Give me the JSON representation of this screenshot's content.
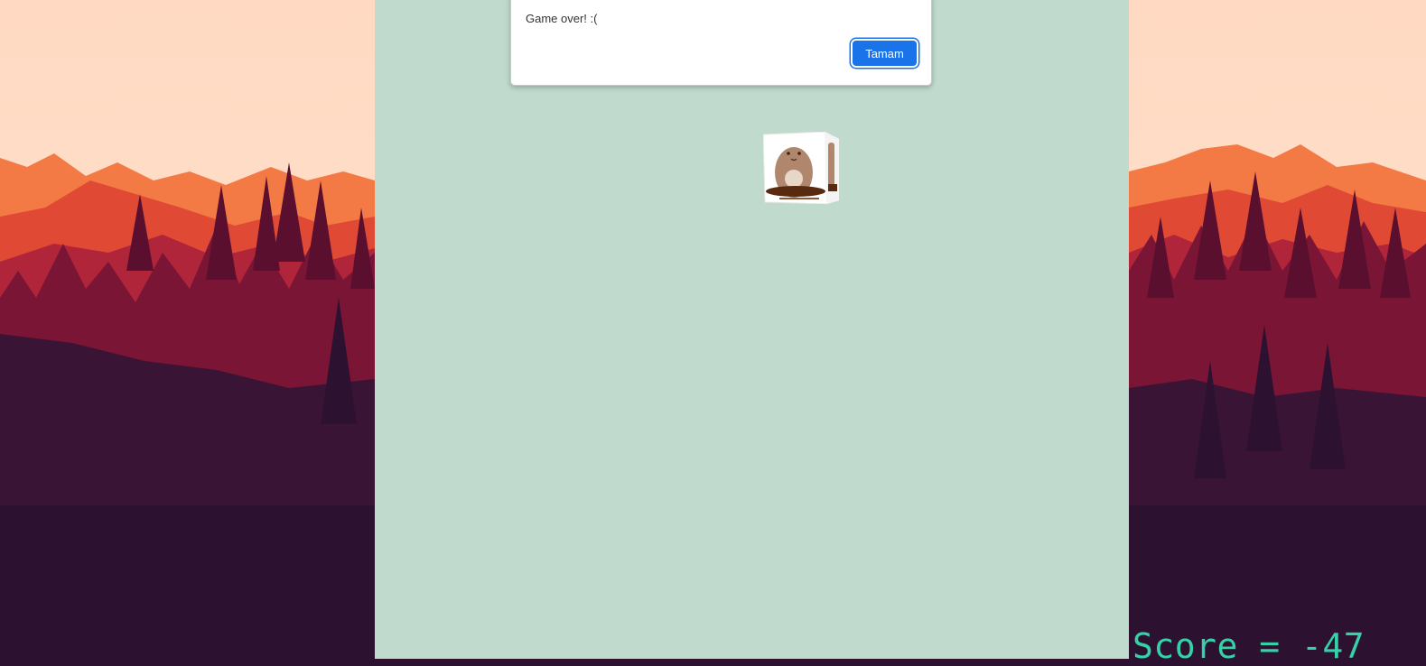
{
  "game": {
    "score_text": "Score = -47"
  },
  "dialog": {
    "message": "Game over! :(",
    "ok_label": "Tamam"
  },
  "colors": {
    "board_background": "#c0dacd",
    "score_color": "#35d1a8",
    "button_accent": "#1a73e8",
    "sky": "#ffdcc5",
    "mountain_far": "#f26a3a",
    "forest_dark": "#2d1130"
  },
  "icons": {
    "mole": "mole-icon"
  }
}
